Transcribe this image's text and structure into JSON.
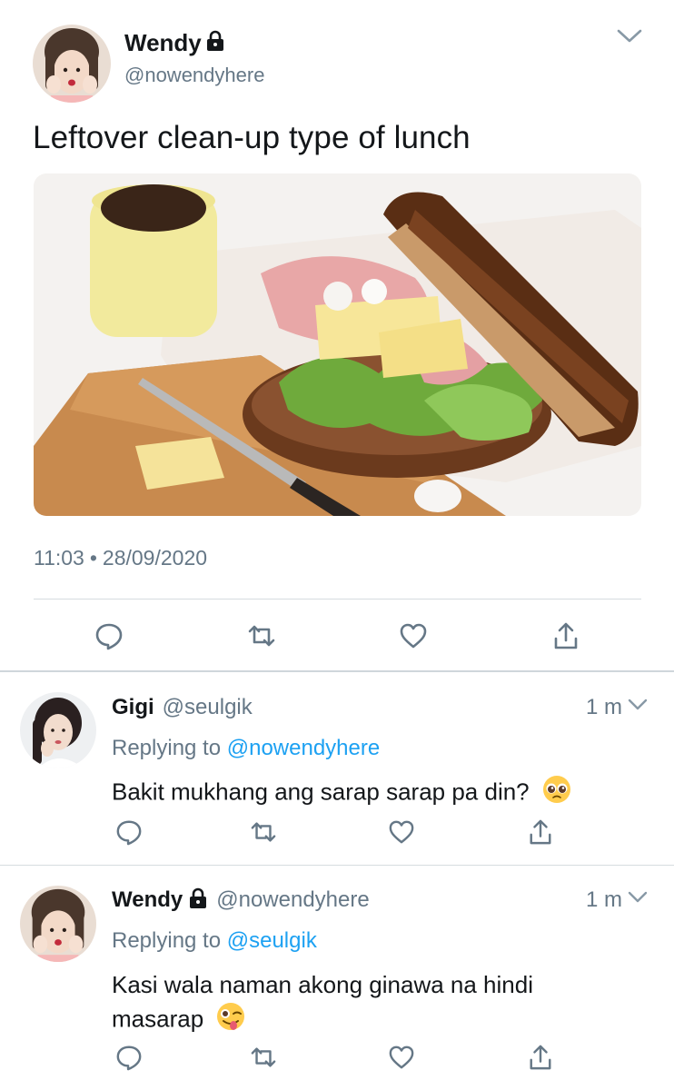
{
  "main_tweet": {
    "name": "Wendy",
    "handle": "@nowendyhere",
    "text": "Leftover clean-up type of lunch",
    "time": "11:03",
    "separator": "•",
    "date": "28/09/2020"
  },
  "replies": [
    {
      "name": "Gigi",
      "handle": "@seulgik",
      "time": "1 m",
      "replying_prefix": "Replying to",
      "replying_to": "@nowendyhere",
      "text": "Bakit mukhang ang sarap sarap pa din?",
      "emoji": "pleading-face"
    },
    {
      "name": "Wendy",
      "handle": "@nowendyhere",
      "time": "1 m",
      "replying_prefix": "Replying to",
      "replying_to": "@seulgik",
      "text_line1": "Kasi wala naman akong ginawa na hindi",
      "text_line2": "masarap",
      "emoji": "winking-tongue-face"
    }
  ],
  "icons": [
    "lock-icon",
    "chevron-down-icon",
    "reply-icon",
    "retweet-icon",
    "like-icon",
    "share-icon"
  ],
  "colors": {
    "text": "#14171a",
    "secondary": "#657786",
    "link": "#1da1f2",
    "divider": "#d6dce0"
  }
}
